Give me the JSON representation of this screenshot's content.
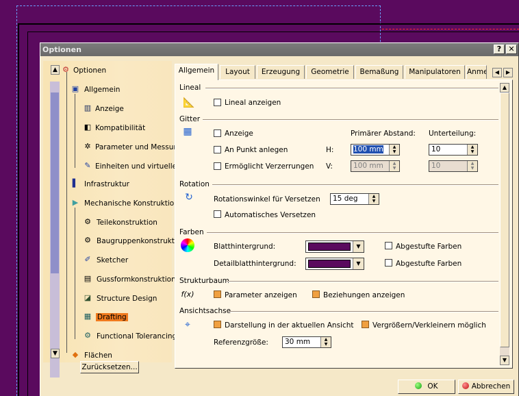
{
  "window": {
    "title": "Optionen",
    "help_glyph": "?",
    "close_glyph": "✕"
  },
  "tree": {
    "items": [
      {
        "label": "Optionen",
        "icon": "options-root-icon"
      },
      {
        "label": "Allgemein",
        "icon": "general-icon"
      },
      {
        "label": "Anzeige",
        "icon": "display-icon"
      },
      {
        "label": "Kompatibilität",
        "icon": "compatibility-icon"
      },
      {
        "label": "Parameter und Messungen",
        "icon": "parameters-icon"
      },
      {
        "label": "Einheiten und virtuelle",
        "icon": "units-icon"
      },
      {
        "label": "Infrastruktur",
        "icon": "infrastructure-icon"
      },
      {
        "label": "Mechanische Konstruktion",
        "icon": "mechanical-design-icon"
      },
      {
        "label": "Teilekonstruktion",
        "icon": "part-design-icon"
      },
      {
        "label": "Baugruppenkonstruktion",
        "icon": "assembly-design-icon"
      },
      {
        "label": "Sketcher",
        "icon": "sketcher-icon"
      },
      {
        "label": "Gussformkonstruktion",
        "icon": "mold-design-icon"
      },
      {
        "label": "Structure Design",
        "icon": "structure-design-icon"
      },
      {
        "label": "Drafting",
        "icon": "drafting-icon",
        "selected": true
      },
      {
        "label": "Functional Tolerancing",
        "icon": "functional-tolerancing-icon"
      },
      {
        "label": "Flächen",
        "icon": "surfaces-icon"
      }
    ],
    "reset_button": "Zurücksetzen..."
  },
  "tabs": [
    "Allgemein",
    "Layout",
    "Erzeugung",
    "Geometrie",
    "Bemaßung",
    "Manipulatoren",
    "Anmerk"
  ],
  "active_tab": "Allgemein",
  "sections": {
    "lineal": {
      "title": "Lineal",
      "show_ruler": {
        "label": "Lineal anzeigen",
        "checked": false
      }
    },
    "gitter": {
      "title": "Gitter",
      "display": {
        "label": "Anzeige",
        "checked": false
      },
      "snap": {
        "label": "An Punkt anlegen",
        "checked": false
      },
      "distortion": {
        "label": "Ermöglicht Verzerrungen",
        "checked": false
      },
      "primary_spacing_label": "Primärer Abstand:",
      "subdivision_label": "Unterteilung:",
      "h_label": "H:",
      "v_label": "V:",
      "h_spacing": "100 mm",
      "h_subdivision": "10",
      "v_spacing": "100 mm",
      "v_subdivision": "10"
    },
    "rotation": {
      "title": "Rotation",
      "angle_label": "Rotationswinkel für Versetzen",
      "angle_value": "15 deg",
      "auto_snap": {
        "label": "Automatisches Versetzen",
        "checked": false
      }
    },
    "farben": {
      "title": "Farben",
      "sheet_bg_label": "Blatthintergrund:",
      "detail_bg_label": "Detailblatthintergrund:",
      "sheet_bg_color": "#5a0a5e",
      "detail_bg_color": "#5a0a5e",
      "gradient1": {
        "label": "Abgestufte Farben",
        "checked": false
      },
      "gradient2": {
        "label": "Abgestufte Farben",
        "checked": false
      }
    },
    "strukturbaum": {
      "title": "Strukturbaum",
      "icon_text": "f(x)",
      "show_params": {
        "label": "Parameter anzeigen",
        "checked": true
      },
      "show_relations": {
        "label": "Beziehungen anzeigen",
        "checked": true
      }
    },
    "ansichtsachse": {
      "title": "Ansichtsachse",
      "show_in_view": {
        "label": "Darstellung in der aktuellen Ansicht",
        "checked": true
      },
      "zoomable": {
        "label": "Vergrößern/Verkleinern möglich",
        "checked": true
      },
      "ref_size_label": "Referenzgröße:",
      "ref_size_value": "30 mm"
    }
  },
  "buttons": {
    "ok": "OK",
    "cancel": "Abbrechen"
  }
}
